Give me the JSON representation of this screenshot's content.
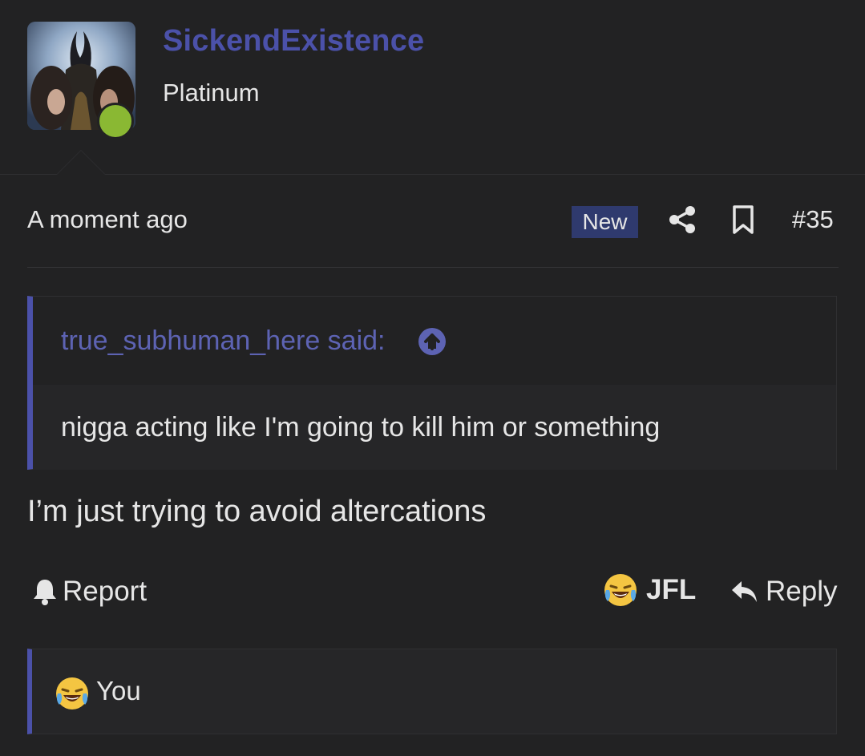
{
  "user": {
    "username": "SickendExistence",
    "title": "Platinum",
    "online": true,
    "online_color": "#8ab833",
    "name_color": "#4b51a9"
  },
  "post": {
    "timestamp": "A moment ago",
    "badge": "New",
    "post_number": "#35",
    "body": "I’m just trying to avoid altercations"
  },
  "quote": {
    "author_line": "true_subhuman_here said:",
    "text": "nigga acting like I'm going to kill him or something"
  },
  "actions": {
    "report_label": "Report",
    "reaction_label": "JFL",
    "reply_label": "Reply"
  },
  "reactions": {
    "summary": "You"
  },
  "icons": {
    "share": "share-icon",
    "bookmark": "bookmark-icon",
    "quote_expand": "arrow-up-circle-icon",
    "report": "bell-icon",
    "reaction": "laughing-crying-emoji-icon",
    "reply": "reply-arrow-icon"
  }
}
